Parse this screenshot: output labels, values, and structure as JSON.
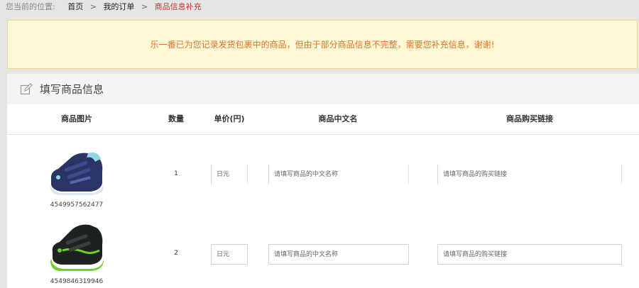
{
  "breadcrumb": {
    "prefix": "您当前的位置:",
    "items": [
      "首页",
      "我的订单"
    ],
    "current": "商品信息补充"
  },
  "notice": "乐一番已为您记录发货包裹中的商品，但由于部分商品信息不完整，需要您补充信息，谢谢!",
  "panel": {
    "title": "填写商品信息",
    "columns": [
      "商品图片",
      "数量",
      "单价(円)",
      "商品中文名",
      "商品购买链接"
    ]
  },
  "rows": [
    {
      "sku": "4549957562477",
      "qty": "1",
      "price_placeholder": "日元",
      "name_placeholder": "请填写商品的中文名称",
      "link_placeholder": "请填写商品的购买链接"
    },
    {
      "sku": "4549846319946",
      "qty": "2",
      "price_placeholder": "日元",
      "name_placeholder": "请填写商品的中文名称",
      "link_placeholder": "请填写商品的购买链接"
    }
  ],
  "colors": {
    "notice_text": "#e0732b",
    "current_crumb": "#c0392b"
  }
}
